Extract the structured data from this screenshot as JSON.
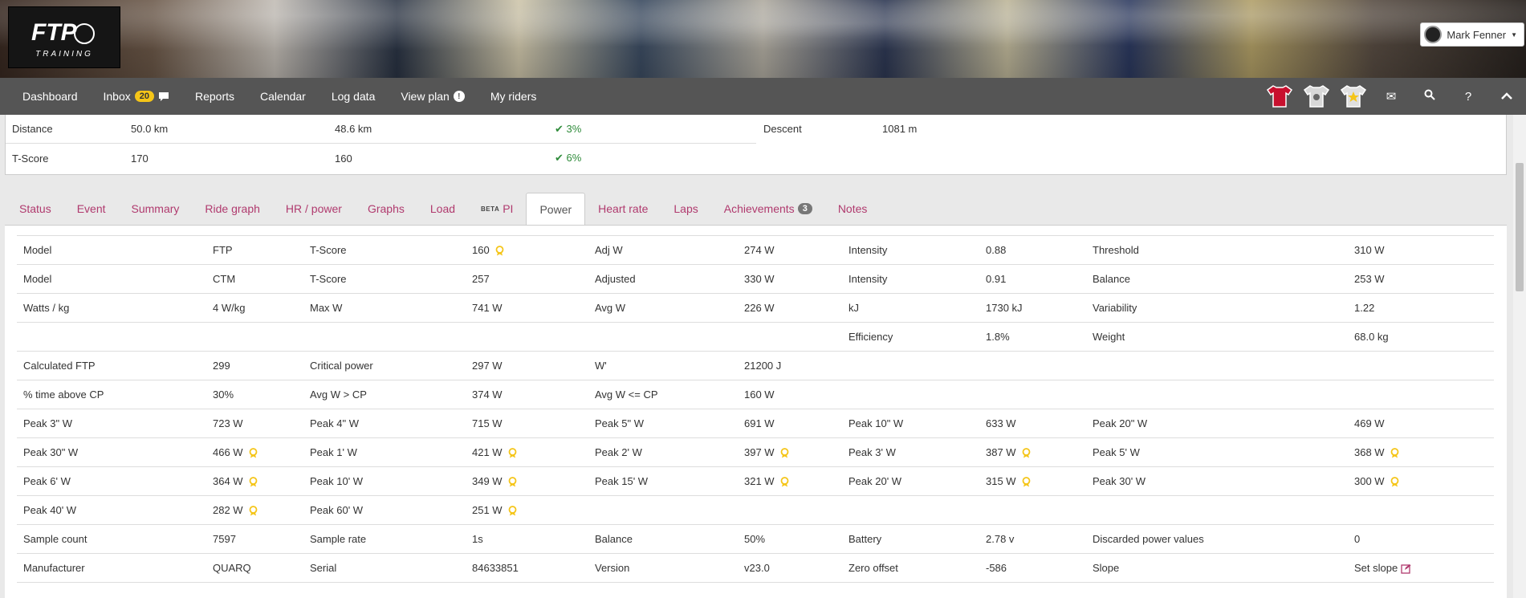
{
  "header": {
    "logo_text": "TRAINING",
    "user_name": "Mark Fenner"
  },
  "nav": {
    "items": [
      {
        "label": "Dashboard"
      },
      {
        "label": "Inbox",
        "badge": "20"
      },
      {
        "label": "Reports"
      },
      {
        "label": "Calendar"
      },
      {
        "label": "Log data"
      },
      {
        "label": "View plan",
        "info": "!"
      },
      {
        "label": "My riders"
      }
    ],
    "right_icons": [
      "red-jersey-icon",
      "polka-jersey-icon",
      "star-jersey-icon",
      "mail-icon",
      "search-icon",
      "help-icon",
      "collapse-icon"
    ]
  },
  "summary": {
    "rows": [
      {
        "label": "Distance",
        "planned": "50.0 km",
        "actual": "48.6 km",
        "diff": "3%"
      },
      {
        "label": "T-Score",
        "planned": "170",
        "actual": "160",
        "diff": "6%"
      }
    ],
    "descent_label": "Descent",
    "descent_value": "1081 m"
  },
  "tabs": {
    "items": [
      "Status",
      "Event",
      "Summary",
      "Ride graph",
      "HR / power",
      "Graphs",
      "Load",
      "PI",
      "Power",
      "Heart rate",
      "Laps",
      "Achievements",
      "Notes"
    ],
    "beta_label": "BETA",
    "achievements_count": "3",
    "active": "Power"
  },
  "power_table": [
    [
      {
        "l": "Model",
        "v": "FTP"
      },
      {
        "l": "T-Score",
        "v": "160",
        "star": true
      },
      {
        "l": "Adj W",
        "v": "274 W"
      },
      {
        "l": "Intensity",
        "v": "0.88"
      },
      {
        "l": "Threshold",
        "v": "310 W"
      }
    ],
    [
      {
        "l": "Model",
        "v": "CTM"
      },
      {
        "l": "T-Score",
        "v": "257"
      },
      {
        "l": "Adjusted",
        "v": "330 W"
      },
      {
        "l": "Intensity",
        "v": "0.91"
      },
      {
        "l": "Balance",
        "v": "253 W"
      }
    ],
    [
      {
        "l": "Watts / kg",
        "v": "4 W/kg"
      },
      {
        "l": "Max W",
        "v": "741 W"
      },
      {
        "l": "Avg W",
        "v": "226 W"
      },
      {
        "l": "kJ",
        "v": "1730 kJ"
      },
      {
        "l": "Variability",
        "v": "1.22"
      }
    ],
    [
      {
        "l": "",
        "v": ""
      },
      {
        "l": "",
        "v": ""
      },
      {
        "l": "",
        "v": ""
      },
      {
        "l": "Efficiency",
        "v": "1.8%"
      },
      {
        "l": "Weight",
        "v": "68.0 kg"
      }
    ],
    [
      {
        "l": "Calculated FTP",
        "v": "299"
      },
      {
        "l": "Critical power",
        "v": "297 W"
      },
      {
        "l": "W'",
        "v": "21200 J"
      },
      {
        "l": "",
        "v": ""
      },
      {
        "l": "",
        "v": ""
      }
    ],
    [
      {
        "l": "% time above CP",
        "v": "30%"
      },
      {
        "l": "Avg W > CP",
        "v": "374 W"
      },
      {
        "l": "Avg W <= CP",
        "v": "160 W"
      },
      {
        "l": "",
        "v": ""
      },
      {
        "l": "",
        "v": ""
      }
    ],
    [
      {
        "l": "Peak 3\" W",
        "v": "723 W"
      },
      {
        "l": "Peak 4\" W",
        "v": "715 W"
      },
      {
        "l": "Peak 5\" W",
        "v": "691 W"
      },
      {
        "l": "Peak 10\" W",
        "v": "633 W"
      },
      {
        "l": "Peak 20\" W",
        "v": "469 W"
      }
    ],
    [
      {
        "l": "Peak 30\" W",
        "v": "466 W",
        "star": true
      },
      {
        "l": "Peak 1' W",
        "v": "421 W",
        "star": true
      },
      {
        "l": "Peak 2' W",
        "v": "397 W",
        "star": true
      },
      {
        "l": "Peak 3' W",
        "v": "387 W",
        "star": true
      },
      {
        "l": "Peak 5' W",
        "v": "368 W",
        "star": true
      }
    ],
    [
      {
        "l": "Peak 6' W",
        "v": "364 W",
        "star": true
      },
      {
        "l": "Peak 10' W",
        "v": "349 W",
        "star": true
      },
      {
        "l": "Peak 15' W",
        "v": "321 W",
        "star": true
      },
      {
        "l": "Peak 20' W",
        "v": "315 W",
        "star": true
      },
      {
        "l": "Peak 30' W",
        "v": "300 W",
        "star": true
      }
    ],
    [
      {
        "l": "Peak 40' W",
        "v": "282 W",
        "star": true
      },
      {
        "l": "Peak 60' W",
        "v": "251 W",
        "star": true
      },
      {
        "l": "",
        "v": ""
      },
      {
        "l": "",
        "v": ""
      },
      {
        "l": "",
        "v": ""
      }
    ],
    [
      {
        "l": "Sample count",
        "v": "7597"
      },
      {
        "l": "Sample rate",
        "v": "1s"
      },
      {
        "l": "Balance",
        "v": "50%"
      },
      {
        "l": "Battery",
        "v": "2.78 v"
      },
      {
        "l": "Discarded power values",
        "v": "0"
      }
    ],
    [
      {
        "l": "Manufacturer",
        "v": "QUARQ"
      },
      {
        "l": "Serial",
        "v": "84633851"
      },
      {
        "l": "Version",
        "v": "v23.0"
      },
      {
        "l": "Zero offset",
        "v": "-586"
      },
      {
        "l": "Slope",
        "v": "Set slope",
        "edit": true
      }
    ]
  ],
  "colors": {
    "navbar": "#555555",
    "tab_link": "#b03a6e",
    "star": "#f5c518",
    "positive": "#2e8b3a"
  }
}
